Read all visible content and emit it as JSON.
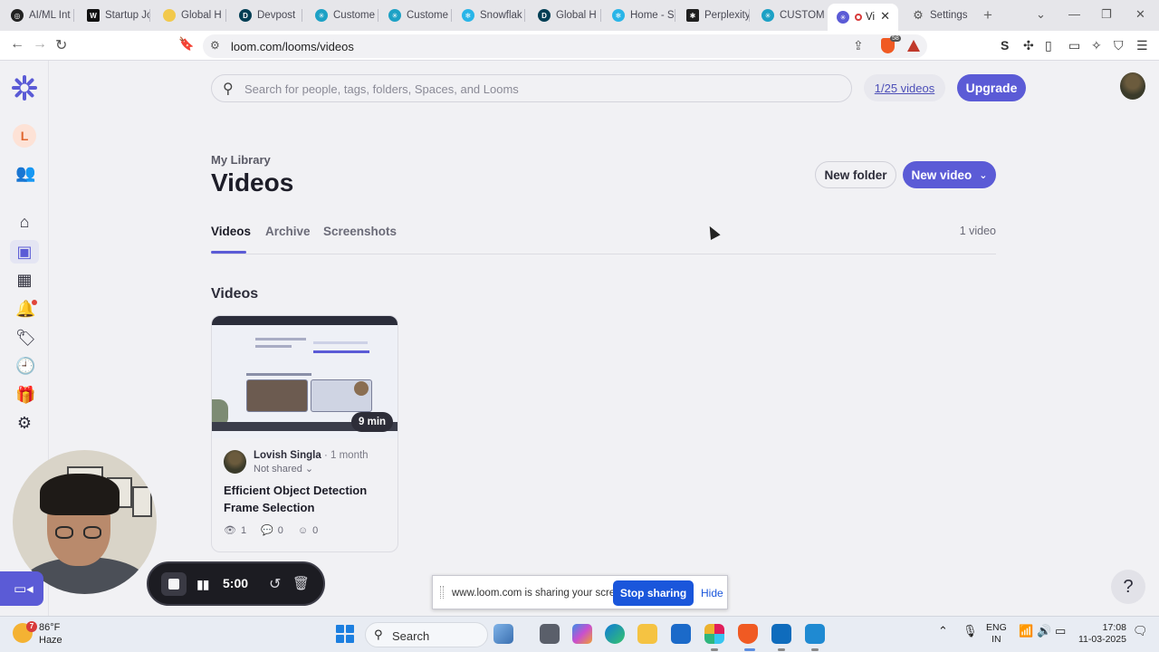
{
  "browser": {
    "tabs": [
      {
        "title": "AI/ML Int",
        "icon": "openai-icon",
        "color": "#222222"
      },
      {
        "title": "Startup Jo",
        "icon": "wellfound-icon",
        "color": "#111111"
      },
      {
        "title": "Global H",
        "icon": "bulb-icon",
        "color": "#f2c94c"
      },
      {
        "title": "Devpost",
        "icon": "devpost-icon",
        "color": "#003e54"
      },
      {
        "title": "Custome",
        "icon": "loom-icon",
        "color": "#1da1c5"
      },
      {
        "title": "Custome",
        "icon": "loom-icon",
        "color": "#1da1c5"
      },
      {
        "title": "Snowflak",
        "icon": "snowflake-icon",
        "color": "#29b5e8"
      },
      {
        "title": "Global H",
        "icon": "devpost-icon",
        "color": "#003e54"
      },
      {
        "title": "Home - S",
        "icon": "snowflake-icon",
        "color": "#29b5e8"
      },
      {
        "title": "Perplexity",
        "icon": "perplexity-icon",
        "color": "#1f1f1f"
      },
      {
        "title": "CUSTOM",
        "icon": "loom-icon",
        "color": "#1da1c5"
      },
      {
        "title": "Vi",
        "icon": "loom-icon",
        "color": "#5b5bd6",
        "active": true
      },
      {
        "title": "Settings",
        "icon": "gear-icon",
        "color": "#555555"
      }
    ],
    "url": "loom.com/looms/videos",
    "brave_badge": "58"
  },
  "search": {
    "placeholder": "Search for people, tags, folders, Spaces, and Looms"
  },
  "header": {
    "quota": "1/25 videos",
    "upgrade": "Upgrade"
  },
  "rail": {
    "workspace_initial": "L"
  },
  "library": {
    "breadcrumb": "My Library",
    "title": "Videos",
    "new_folder": "New folder",
    "new_video": "New video",
    "tabs": [
      "Videos",
      "Archive",
      "Screenshots"
    ],
    "count": "1 video",
    "section": "Videos"
  },
  "video": {
    "duration": "9 min",
    "author": "Lovish Singla",
    "age": "1 month",
    "sharing": "Not shared",
    "title": "Efficient Object Detection Frame Selection",
    "views": "1",
    "comments": "0",
    "reactions": "0"
  },
  "recorder": {
    "time": "5:00"
  },
  "sharebar": {
    "text": "www.loom.com is sharing your screen.",
    "stop": "Stop sharing",
    "hide": "Hide"
  },
  "help": {
    "label": "?"
  },
  "taskbar": {
    "weather_temp": "86°F",
    "weather_desc": "Haze",
    "weather_badge": "7",
    "search": "Search",
    "lang_1": "ENG",
    "lang_2": "IN",
    "time": "17:08",
    "date": "11-03-2025"
  },
  "colors": {
    "accent": "#5b5bd6",
    "share_blue": "#1a56db"
  }
}
